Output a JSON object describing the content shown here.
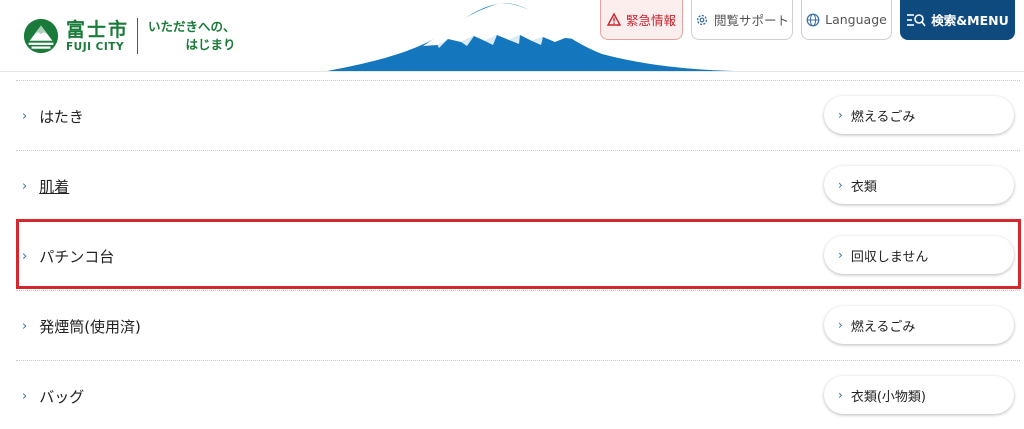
{
  "header": {
    "logo": {
      "name": "富士市",
      "name_en": "FUJI CITY",
      "tagline_1": "いただきへの、",
      "tagline_2": "はじまり"
    },
    "buttons": {
      "emergency": "緊急情報",
      "support": "閲覧サポート",
      "language": "Language",
      "menu": "検索&MENU"
    }
  },
  "colors": {
    "brand_green": "#1a7a3a",
    "menu_navy": "#0e4a7e",
    "emergency_red": "#c8232c",
    "highlight_red": "#d4272e"
  },
  "items": [
    {
      "name": "はたき",
      "category": "燃えるごみ"
    },
    {
      "name": "肌着",
      "category": "衣類"
    },
    {
      "name": "パチンコ台",
      "category": "回収しません"
    },
    {
      "name": "発煙筒(使用済)",
      "category": "燃えるごみ"
    },
    {
      "name": "バッグ",
      "category": "衣類(小物類)"
    }
  ]
}
